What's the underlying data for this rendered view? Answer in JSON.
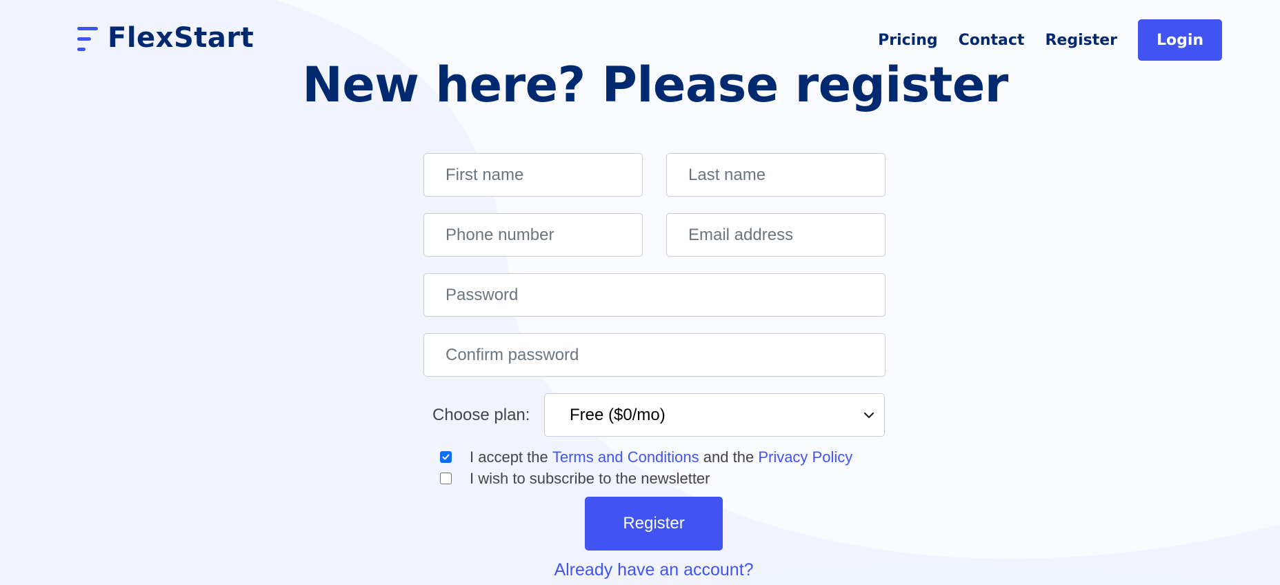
{
  "brand": {
    "name": "FlexStart",
    "accent": "#4154f1",
    "primary_text": "#012970"
  },
  "nav": {
    "links": [
      "Pricing",
      "Contact",
      "Register"
    ],
    "login_label": "Login"
  },
  "page_title": "New here? Please register",
  "form": {
    "first_name_placeholder": "First name",
    "last_name_placeholder": "Last name",
    "phone_placeholder": "Phone number",
    "email_placeholder": "Email address",
    "password_placeholder": "Password",
    "confirm_password_placeholder": "Confirm password",
    "plan_label": "Choose plan:",
    "plan_selected": "Free ($0/mo)",
    "terms": {
      "checked": true,
      "prefix": "I accept the",
      "terms_link": "Terms and Conditions",
      "middle": "and the",
      "privacy_link": "Privacy Policy"
    },
    "newsletter": {
      "checked": false,
      "label": "I wish to subscribe to the newsletter"
    },
    "submit_label": "Register",
    "login_link": "Already have an account?"
  }
}
